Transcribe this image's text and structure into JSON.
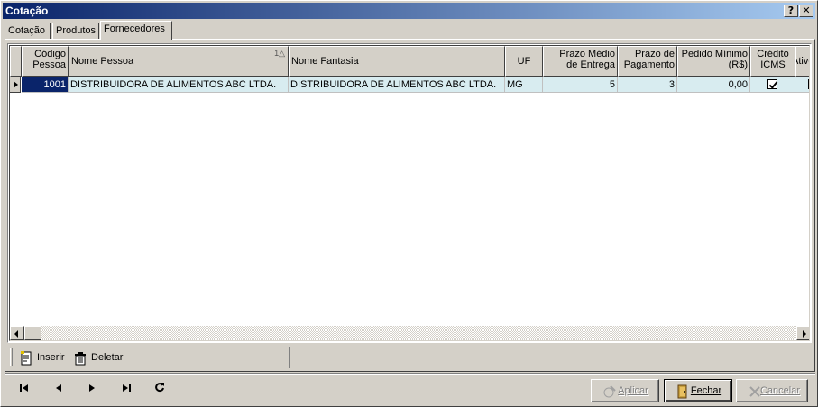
{
  "window": {
    "title": "Cotação",
    "help_label": "?",
    "close_label": "✕"
  },
  "tabs": [
    {
      "label": "Cotação"
    },
    {
      "label": "Produtos"
    },
    {
      "label": "Fornecedores"
    }
  ],
  "grid": {
    "columns": [
      {
        "label": "Código Pessoa"
      },
      {
        "label": "Nome Pessoa",
        "sort": "1△"
      },
      {
        "label": "Nome Fantasia"
      },
      {
        "label": "UF"
      },
      {
        "label": "Prazo Médio de Entrega"
      },
      {
        "label": "Prazo de Pagamento"
      },
      {
        "label": "Pedido Mínimo (R$)"
      },
      {
        "label": "Crédito ICMS"
      },
      {
        "label": "Ativo"
      }
    ],
    "rows": [
      {
        "codigo": "1001",
        "nome_pessoa": "DISTRIBUIDORA DE ALIMENTOS ABC LTDA.",
        "nome_fantasia": "DISTRIBUIDORA DE ALIMENTOS ABC LTDA.",
        "uf": "MG",
        "prazo_entrega": "5",
        "prazo_pagamento": "3",
        "pedido_minimo": "0,00",
        "credito_icms": true
      }
    ]
  },
  "toolbar": {
    "insert_label": "Inserir",
    "delete_label": "Deletar"
  },
  "nav": {
    "first": "|◀",
    "prev": "◀",
    "next": "▶",
    "last": "▶|",
    "refresh": "↻"
  },
  "buttons": {
    "apply": "Aplicar",
    "close": "Fechar",
    "cancel": "Cancelar"
  },
  "colors": {
    "title_start": "#0a246a",
    "title_end": "#a6caf0",
    "row_bg": "#d8ecf0",
    "face": "#d4d0c8"
  }
}
